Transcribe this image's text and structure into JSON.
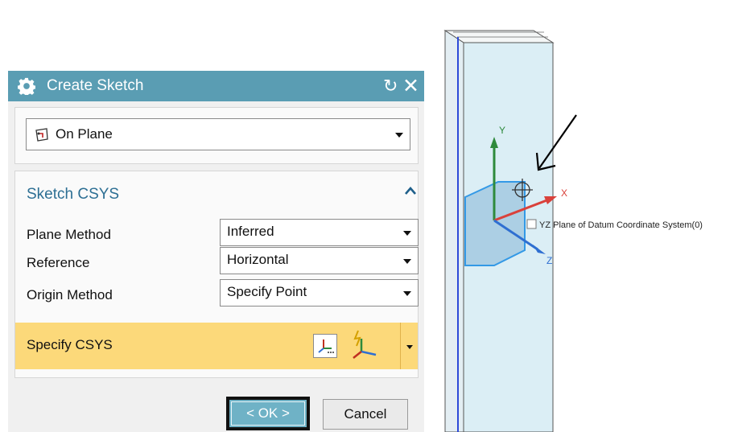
{
  "dialog": {
    "title": "Create Sketch",
    "sketch_type": {
      "value": "On Plane"
    },
    "sketch_csys": {
      "title": "Sketch CSYS",
      "plane_method": {
        "label": "Plane Method",
        "value": "Inferred"
      },
      "reference": {
        "label": "Reference",
        "value": "Horizontal"
      },
      "origin_method": {
        "label": "Origin Method",
        "value": "Specify Point"
      },
      "specify_csys": {
        "label": "Specify CSYS"
      }
    },
    "ok_label": "< OK >",
    "cancel_label": "Cancel"
  },
  "viewport": {
    "axis_labels": {
      "x": "X",
      "y": "Y",
      "z": "Z"
    },
    "tooltip": "YZ Plane of Datum Coordinate System(0)"
  },
  "colors": {
    "titlebar": "#5a9db3",
    "section_title": "#2d6f94",
    "highlight_row": "#fcd97a",
    "ok_button": "#6fb2c6",
    "part_face": "#dbeef5",
    "plane": "#9cc4de",
    "x_axis": "#d9413b",
    "y_axis": "#2e8a3c",
    "z_axis": "#2f6fd1"
  }
}
